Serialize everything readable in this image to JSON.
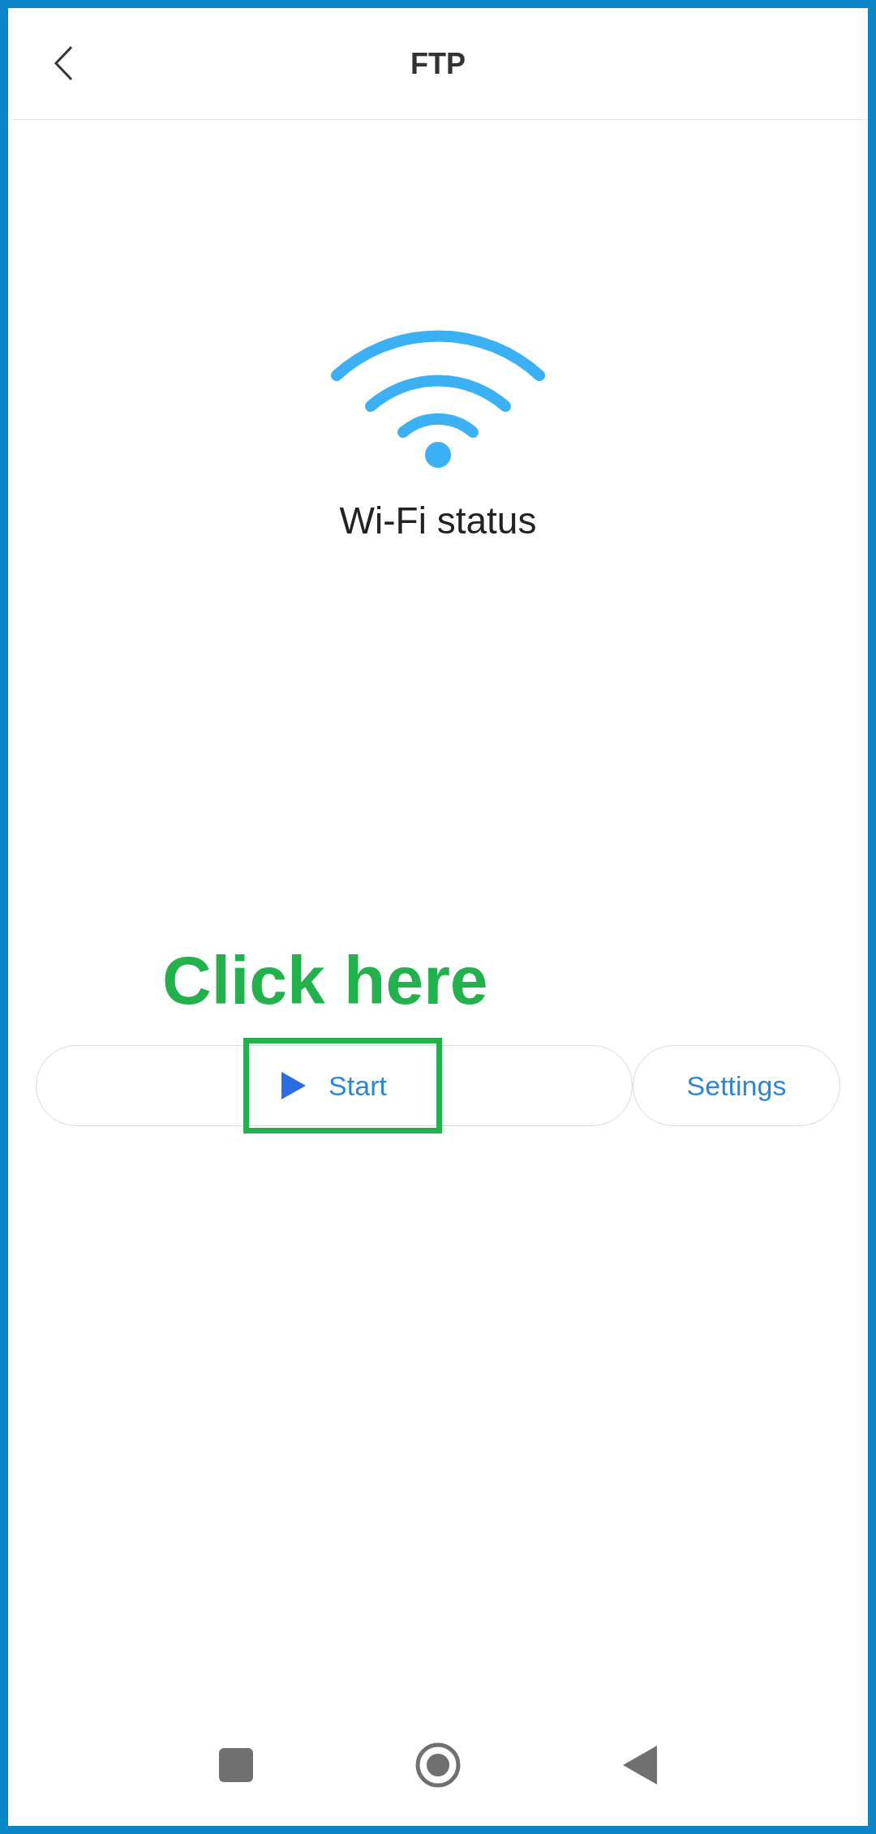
{
  "header": {
    "title": "FTP"
  },
  "status": {
    "label": "Wi-Fi status"
  },
  "annotation": {
    "text": "Click here"
  },
  "actions": [
    {
      "kind": "start",
      "label": "Start",
      "highlighted": true
    },
    {
      "kind": "settings",
      "label": "Settings",
      "highlighted": false
    }
  ]
}
